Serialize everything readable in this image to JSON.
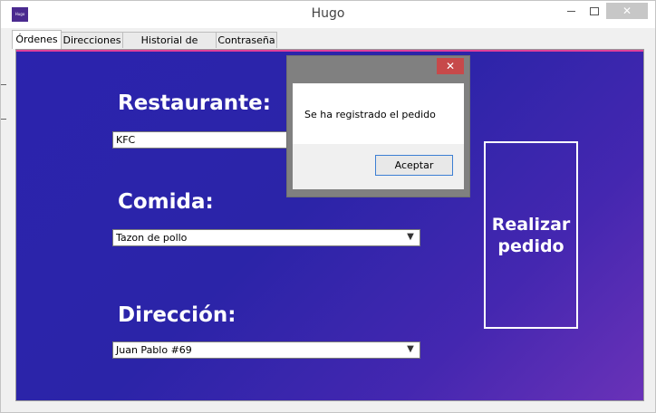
{
  "window": {
    "title": "Hugo",
    "icon": "app-logo-icon",
    "icon_text": "Hugo"
  },
  "tabs": [
    {
      "label": "Órdenes",
      "active": true
    },
    {
      "label": "Direcciones",
      "active": false
    },
    {
      "label": "Historial de órdenes",
      "active": false
    },
    {
      "label": "Contraseña",
      "active": false
    }
  ],
  "form": {
    "restaurant_label": "Restaurante:",
    "restaurant_value": "KFC",
    "food_label": "Comida:",
    "food_value": "Tazon de pollo",
    "address_label": "Dirección:",
    "address_value": "Juan Pablo #69",
    "submit_label_line1": "Realizar",
    "submit_label_line2": "pedido"
  },
  "dialog": {
    "message": "Se ha registrado el pedido",
    "ok_label": "Aceptar",
    "close_glyph": "✕"
  },
  "colors": {
    "panel_gradient_start": "#2b23ad",
    "panel_gradient_end": "#6a32b8",
    "accent_line": "#e0409a",
    "dialog_close": "#c7494a"
  }
}
